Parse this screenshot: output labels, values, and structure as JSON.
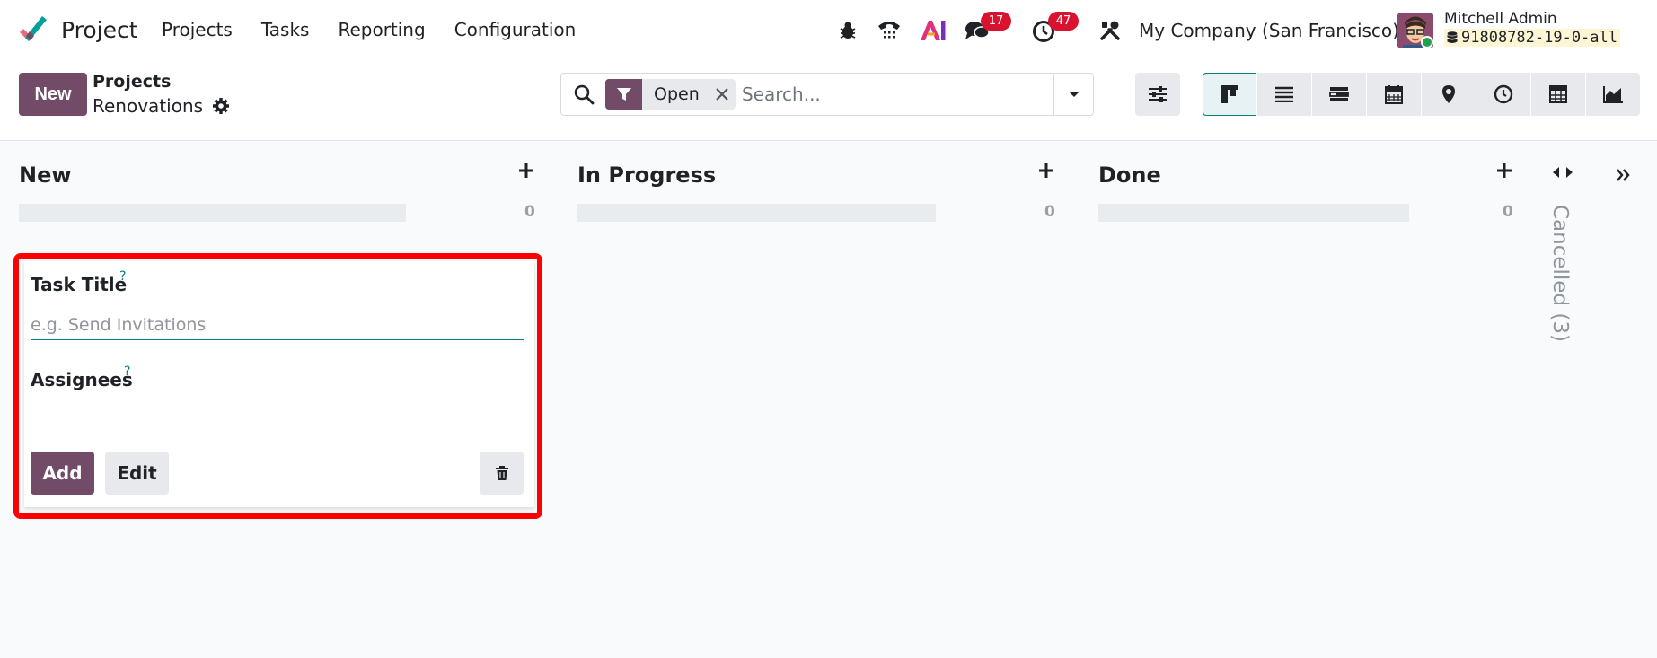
{
  "app": {
    "name": "Project",
    "accent": "#714b67",
    "brand_colors": [
      "#00a09d",
      "#e46e78",
      "#714b67"
    ]
  },
  "menu": [
    "Projects",
    "Tasks",
    "Reporting",
    "Configuration"
  ],
  "systray": {
    "messages_count": "17",
    "activities_count": "47",
    "company": "My Company (San Francisco)",
    "user_name": "Mitchell Admin",
    "database": "91808782-19-0-all"
  },
  "control_panel": {
    "new_label": "New",
    "breadcrumb_parent": "Projects",
    "breadcrumb_current": "Renovations",
    "facet_label": "Open",
    "search_placeholder": "Search..."
  },
  "kanban": {
    "columns": [
      {
        "title": "New",
        "count": "0"
      },
      {
        "title": "In Progress",
        "count": "0"
      },
      {
        "title": "Done",
        "count": "0"
      }
    ],
    "folded_column": "Cancelled (3)"
  },
  "quick_create": {
    "title_label": "Task Title",
    "title_placeholder": "e.g. Send Invitations",
    "assignees_label": "Assignees",
    "help_mark": "?",
    "add_label": "Add",
    "edit_label": "Edit",
    "highlight_color": "#ff0000"
  }
}
